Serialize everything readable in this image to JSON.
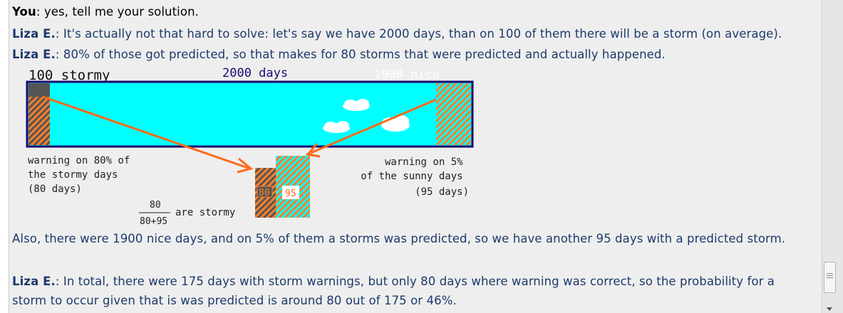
{
  "chat": {
    "m1": {
      "speaker": "You",
      "text": ": yes, tell me your solution."
    },
    "m2": {
      "speaker": "Liza E.",
      "text": ": It's actually not that hard to solve: let's say we have 2000 days, than on 100 of them there will be a storm (on average)."
    },
    "m3": {
      "speaker": "Liza E.",
      "text": ": 80% of those got predicted, so that makes for 80 storms that were predicted and actually happened."
    },
    "m4": {
      "text": "Also, there were 1900 nice days, and on 5% of them a storms was predicted, so we have another 95 days with a predicted storm."
    },
    "m5": {
      "speaker": "Liza E.",
      "text": ": In total, there were 175 days with storm warnings, but only 80 days where warning was correct, so the probability for a storm to occur given that is was predicted is around 80 out of 175 or 46%."
    }
  },
  "diagram": {
    "label_stormy": "100 stormy",
    "label_total": "2000 days",
    "label_nice": "1900 nice",
    "left_note": [
      "warning on 80% of",
      "the stormy days",
      "(80 days)"
    ],
    "right_note": [
      "warning on 5%",
      "of the sunny days",
      "(95 days)"
    ],
    "box_stormy": "80",
    "box_sunny": "95",
    "frac_num": "80",
    "frac_den": "80+95",
    "frac_text": "are stormy",
    "colors": {
      "sky": "#00ffff",
      "border": "#1b0a6e",
      "storm": "#555555",
      "hatch": "#ff7f2a",
      "arrow": "#ff6a1a",
      "cloud": "#ffffff"
    }
  }
}
